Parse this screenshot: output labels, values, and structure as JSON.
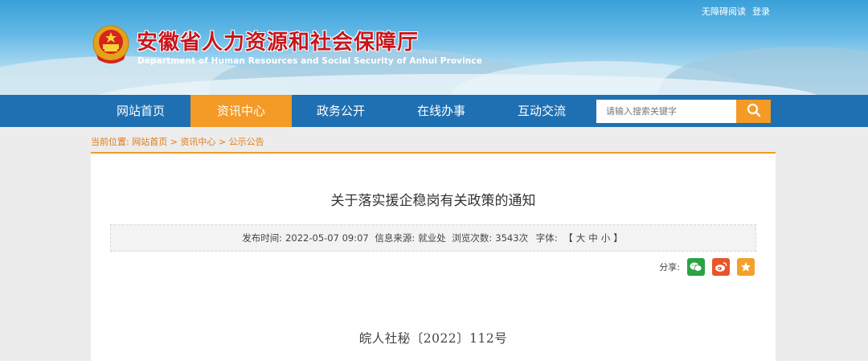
{
  "header": {
    "top_links": [
      "无障碍阅读",
      "登录"
    ],
    "title_cn": "安徽省人力资源和社会保障厅",
    "title_en": "Department of Human Resources and Social Security of Anhui Province"
  },
  "nav": {
    "items": [
      "网站首页",
      "资讯中心",
      "政务公开",
      "在线办事",
      "互动交流"
    ],
    "active_index": 1,
    "search_placeholder": "请输入搜索关键字"
  },
  "breadcrumb": {
    "prefix": "当前位置:",
    "items": [
      "网站首页",
      "资讯中心",
      "公示公告"
    ],
    "separator": ">"
  },
  "article": {
    "title": "关于落实援企稳岗有关政策的通知",
    "meta": {
      "publish_label": "发布时间:",
      "publish_time": "2022-05-07 09:07",
      "source_label": "信息来源:",
      "source": "就业处",
      "views_label": "浏览次数:",
      "views": "3543次",
      "font_label": "字体:",
      "font_open": "【",
      "font_large": "大",
      "font_medium": "中",
      "font_small": "小",
      "font_close": "】"
    },
    "share_label": "分享:",
    "share_icons": [
      "wechat-icon",
      "weibo-icon",
      "favorite-star-icon"
    ],
    "doc_number": "皖人社秘〔2022〕112号"
  },
  "colors": {
    "nav_bg": "#1f70b3",
    "accent_orange": "#f39a27",
    "title_red": "#c8161d",
    "breadcrumb_orange": "#e47a12"
  }
}
